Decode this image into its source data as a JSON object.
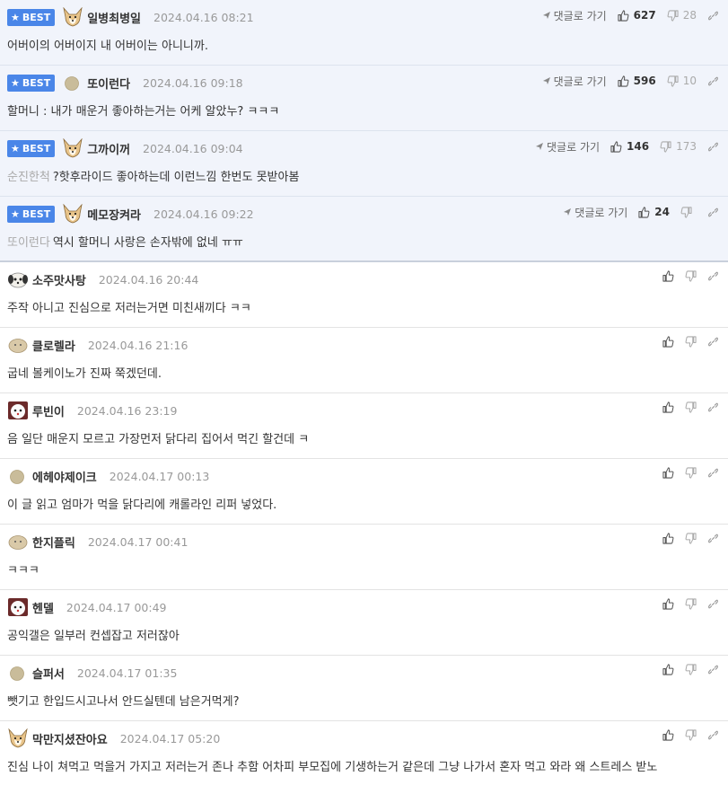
{
  "labels": {
    "best": "BEST",
    "goto": "댓글로 가기"
  },
  "best": [
    {
      "nick": "일병최병일",
      "date": "2024.04.16 08:21",
      "avatar": "dog-icon",
      "reply_to": "",
      "text": "어버이의 어버이지 내 어버이는 아니니까.",
      "likes": "627",
      "dislikes": "28"
    },
    {
      "nick": "또이런다",
      "date": "2024.04.16 09:18",
      "avatar": "dot-icon",
      "reply_to": "",
      "text": "할머니 : 내가 매운거 좋아하는거는 어케 알았누? ㅋㅋㅋ",
      "likes": "596",
      "dislikes": "10"
    },
    {
      "nick": "그까이꺼",
      "date": "2024.04.16 09:04",
      "avatar": "dog-icon",
      "reply_to": "순진한척",
      "text": "?핫후라이드 좋아하는데 이런느낌 한번도 못받아봄",
      "likes": "146",
      "dislikes": "173"
    },
    {
      "nick": "메모장켜라",
      "date": "2024.04.16 09:22",
      "avatar": "dog-icon",
      "reply_to": "또이런다",
      "text": "역시 할머니 사랑은 손자밖에 없네 ㅠㅠ",
      "likes": "24",
      "dislikes": ""
    }
  ],
  "comments": [
    {
      "nick": "소주맛사탕",
      "date": "2024.04.16 20:44",
      "avatar": "puppy-icon",
      "text": "주작 아니고 진심으로 저러는거면 미친새끼다 ㅋㅋ"
    },
    {
      "nick": "클로렐라",
      "date": "2024.04.16 21:16",
      "avatar": "blob-icon",
      "text": "굽네 볼케이노가 진짜 쭉겠던데."
    },
    {
      "nick": "루빈이",
      "date": "2024.04.16 23:19",
      "avatar": "white-dog-icon",
      "text": "음 일단 매운지 모르고 가장먼저 닭다리 집어서 먹긴 할건데 ㅋ"
    },
    {
      "nick": "에헤야제이크",
      "date": "2024.04.17 00:13",
      "avatar": "dot-icon",
      "text": "이 글 읽고 엄마가 먹을 닭다리에 캐롤라인 리퍼 넣었다."
    },
    {
      "nick": "한지플릭",
      "date": "2024.04.17 00:41",
      "avatar": "blob-icon",
      "text": "ㅋㅋㅋ"
    },
    {
      "nick": "헨델",
      "date": "2024.04.17 00:49",
      "avatar": "white-dog-icon",
      "text": "공익갤은 일부러 컨셉잡고 저러잖아"
    },
    {
      "nick": "슬퍼서",
      "date": "2024.04.17 01:35",
      "avatar": "dot-icon",
      "text": "뺏기고 한입드시고나서 안드실텐데 남은거먹게?"
    },
    {
      "nick": "막만지셨잔아요",
      "date": "2024.04.17 05:20",
      "avatar": "dog-icon",
      "text": "진심 나이 쳐먹고 먹을거 가지고 저러는거 존나 추함 어차피 부모집에 기생하는거 같은데 그냥 나가서 혼자 먹고 와라 왜 스트레스 받노"
    }
  ]
}
